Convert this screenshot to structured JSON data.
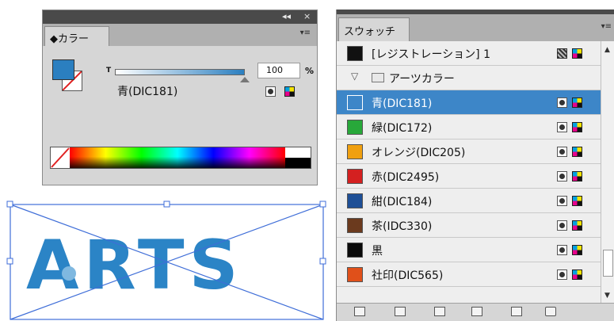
{
  "color_panel": {
    "title_controls": {
      "collapse": "◂◂",
      "close": "×"
    },
    "tab_label": "◆カラー",
    "menu_icon": "panel-menu-icon",
    "tint_label": "T",
    "tint_value": "100",
    "tint_unit": "%",
    "tint_level": 1.0,
    "swatch_name": "青(DIC181)",
    "fill_color": "#2b7fc0"
  },
  "swatches_panel": {
    "tab_label": "スウォッチ",
    "menu_icon": "panel-menu-icon",
    "rows": [
      {
        "label": "[レジストレーション] 1",
        "color": "#111111",
        "type": "registration"
      },
      {
        "label": "アーツカラー",
        "type": "folder"
      },
      {
        "label": "青(DIC181)",
        "color": "#3d86c8",
        "selected": true
      },
      {
        "label": "緑(DIC172)",
        "color": "#28a83a"
      },
      {
        "label": "オレンジ(DIC205)",
        "color": "#f0a010"
      },
      {
        "label": "赤(DIC2495)",
        "color": "#d42020"
      },
      {
        "label": "紺(DIC184)",
        "color": "#1e4f96"
      },
      {
        "label": "茶(IDC330)",
        "color": "#6b3a1e"
      },
      {
        "label": "黒",
        "color": "#0a0a0a"
      },
      {
        "label": "社印(DIC565)",
        "color": "#e0501a"
      }
    ],
    "footer_icons": [
      "swatch-library-icon",
      "show-kinds-icon",
      "swatch-options-icon",
      "new-color-group-icon",
      "new-swatch-icon",
      "delete-swatch-icon"
    ]
  },
  "artboard": {
    "text": "ARTS",
    "text_color": "#2b84c6"
  }
}
